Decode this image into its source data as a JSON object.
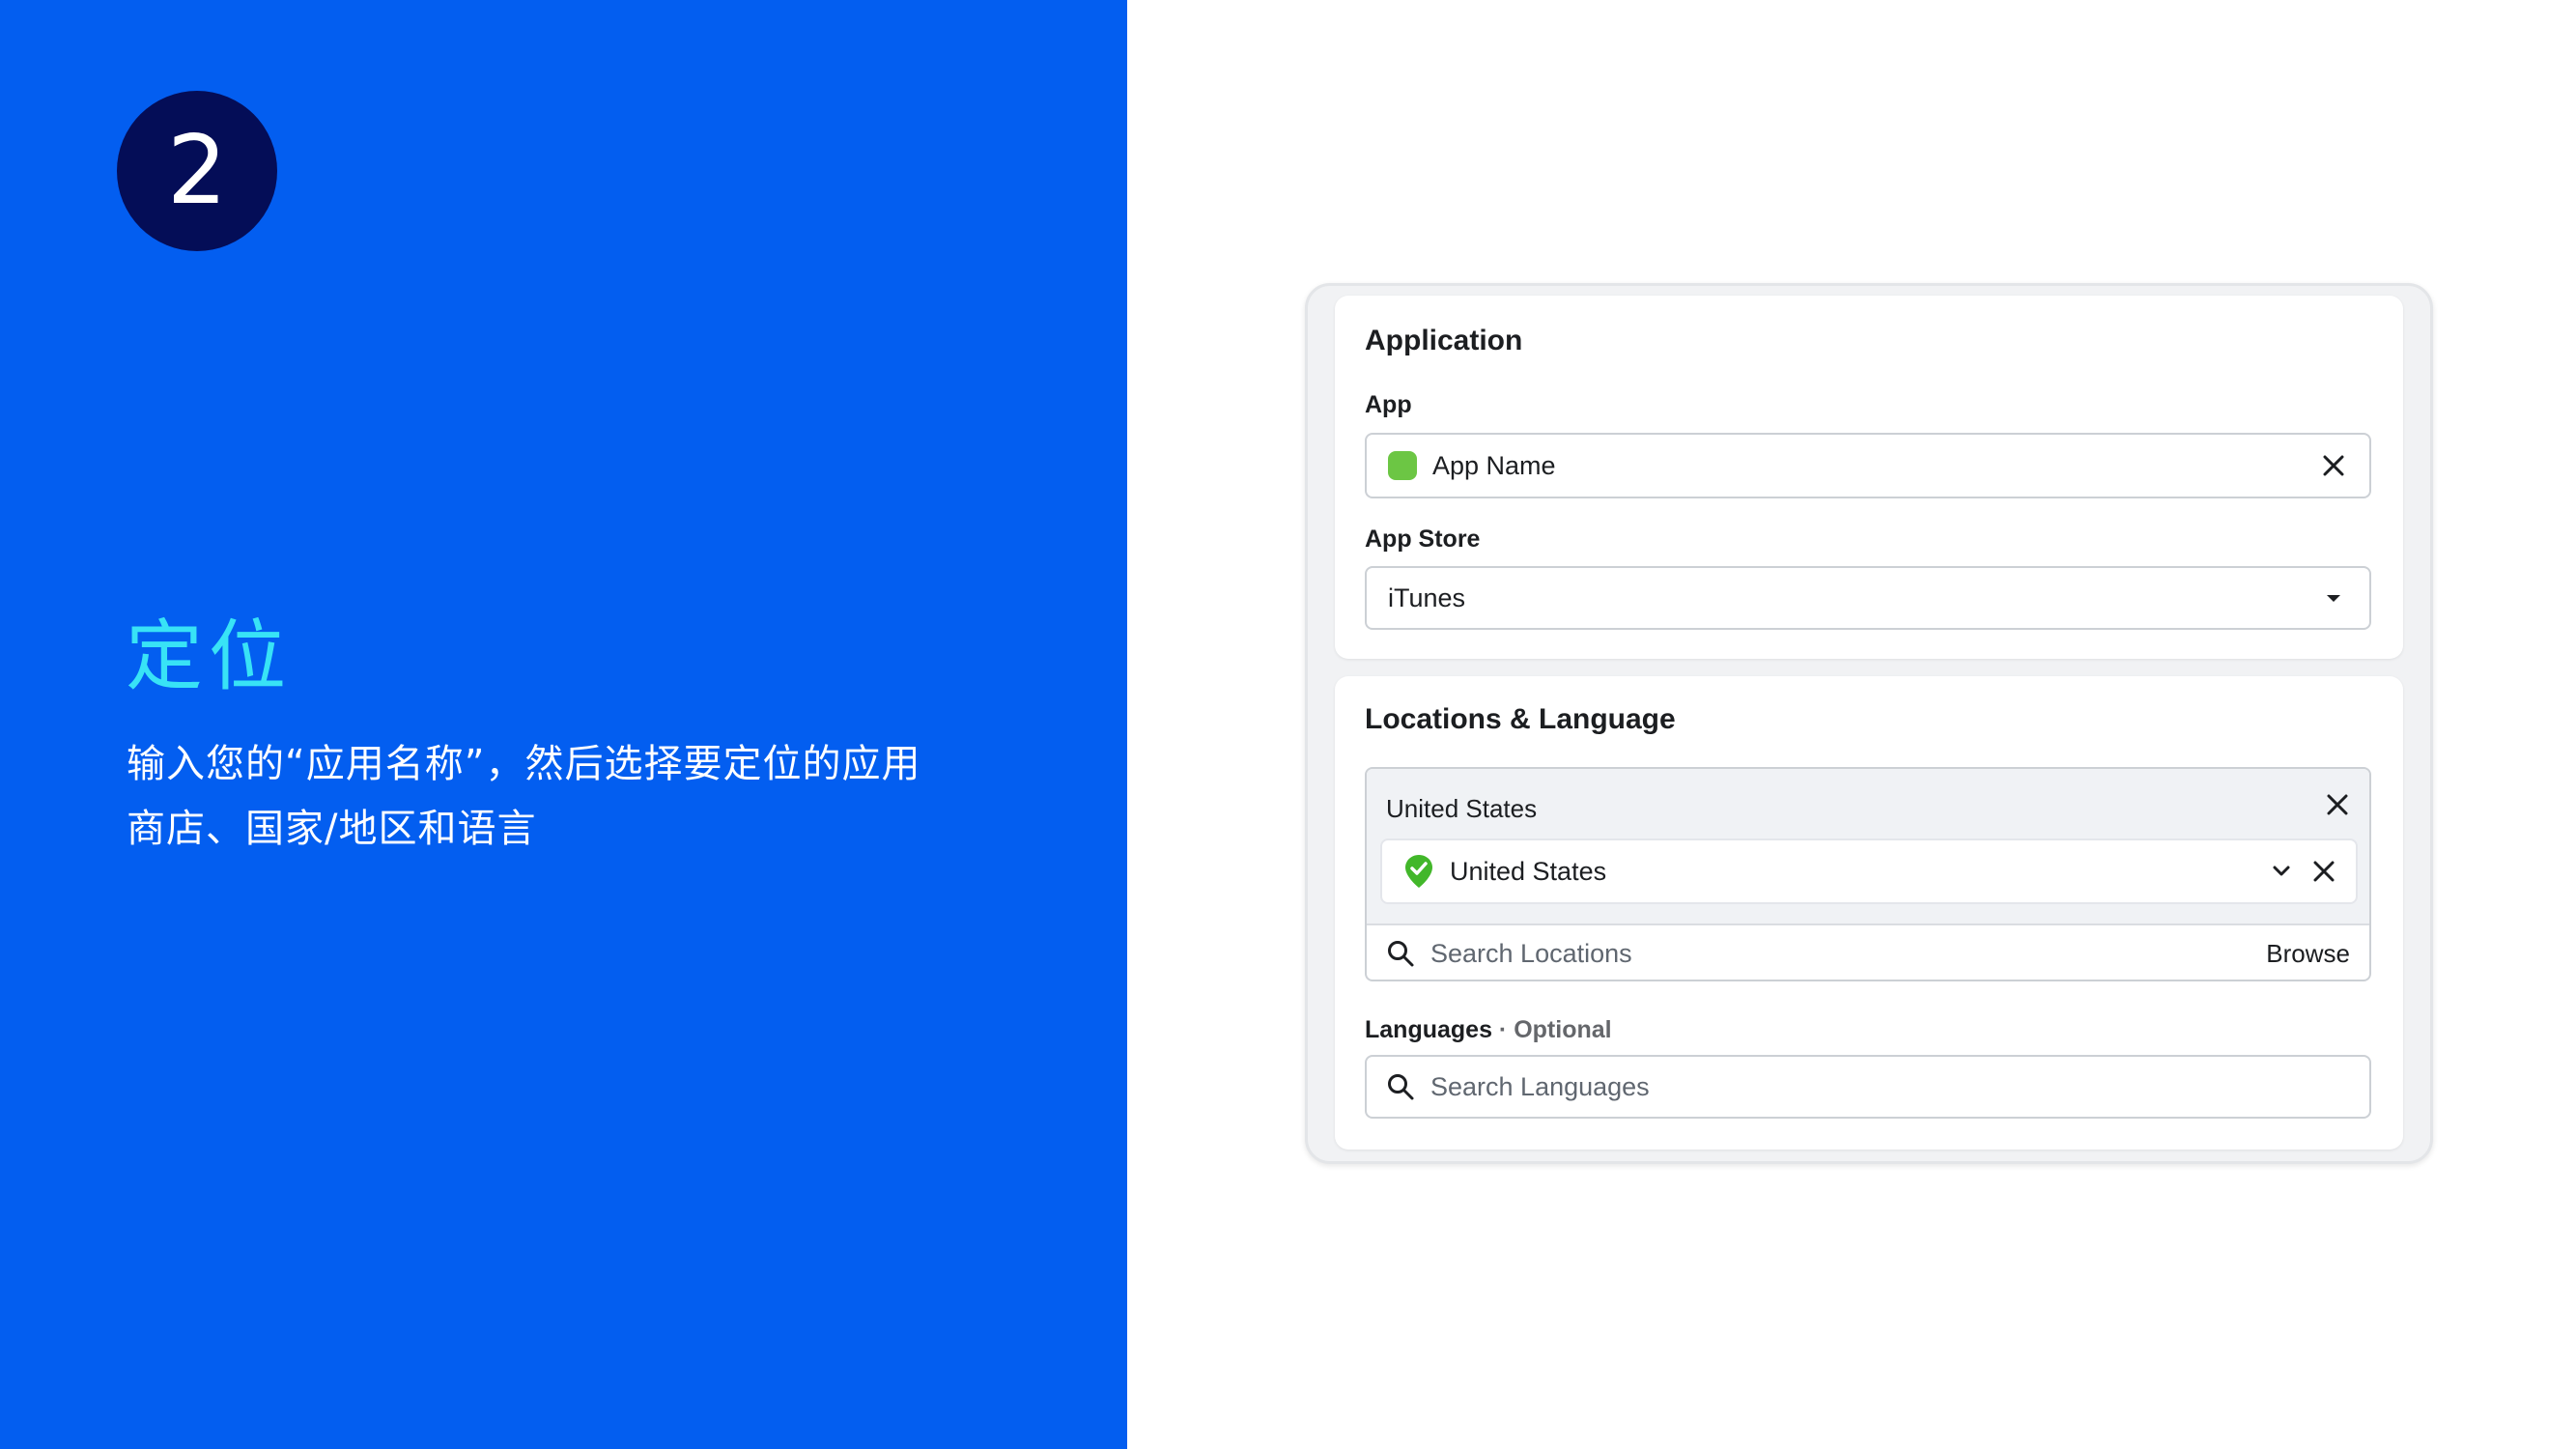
{
  "slide": {
    "step_number": "2",
    "title": "定位",
    "description": "输入您的“应用名称”，然后选择要定位的应用商店、国家/地区和语言"
  },
  "application_card": {
    "heading": "Application",
    "app_label": "App",
    "app_value": "App Name",
    "store_label": "App Store",
    "store_value": "iTunes"
  },
  "locations_card": {
    "heading": "Locations & Language",
    "group_title": "United States",
    "selected_location": "United States",
    "search_placeholder": "Search Locations",
    "browse_label": "Browse",
    "languages_label": "Languages",
    "languages_optional": " · Optional",
    "languages_placeholder": "Search Languages"
  },
  "colors": {
    "left_panel": "#035ef0",
    "badge": "#040d57",
    "title_accent": "#38e3f6",
    "app_icon": "#6cc644",
    "location_pin": "#42b72a"
  },
  "icons": [
    "close-icon",
    "caret-down-icon",
    "location-shield-icon",
    "chevron-down-icon",
    "search-icon"
  ]
}
